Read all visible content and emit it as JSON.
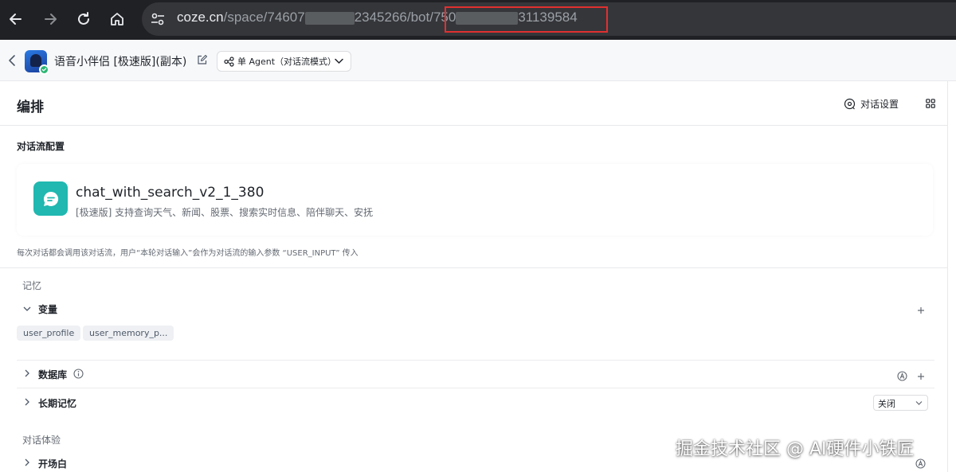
{
  "browser": {
    "url_host": "coze.cn",
    "url_path_a": "/space/74607",
    "url_path_b": "2345266/bot/750",
    "url_path_c": "31139584",
    "colors": {
      "bar": "#202124",
      "omnibox": "#35363a",
      "highlight": "#e03030"
    },
    "icons": [
      "back-arrow-icon",
      "forward-arrow-icon",
      "reload-icon",
      "home-icon",
      "site-info-icon"
    ]
  },
  "header": {
    "bot_name": "语音小伴侣 [极速版](副本)",
    "mode_label": "单 Agent（对话流模式）"
  },
  "main": {
    "title": "编排",
    "dialog_settings_label": "对话设置",
    "flow_section_label": "对话流配置",
    "flow": {
      "name": "chat_with_search_v2_1_380",
      "description": "[极速版] 支持查询天气、新闻、股票、搜索实时信息、陪伴聊天、安抚",
      "accent": "#20b8b0"
    },
    "flow_note": "每次对话都会调用该对话流，用户“本轮对话输入”会作为对话流的输入参数 “USER_INPUT” 传入",
    "memory": {
      "group_label": "记忆",
      "variables_title": "变量",
      "variable_tags": [
        "user_profile",
        "user_memory_p..."
      ],
      "database_title": "数据库",
      "long_memory_title": "长期记忆",
      "long_memory_value": "关闭"
    },
    "experience": {
      "group_label": "对话体验",
      "opening_title": "开场白"
    }
  },
  "watermark": "掘金技术社区 @ AI硬件小铁匠"
}
